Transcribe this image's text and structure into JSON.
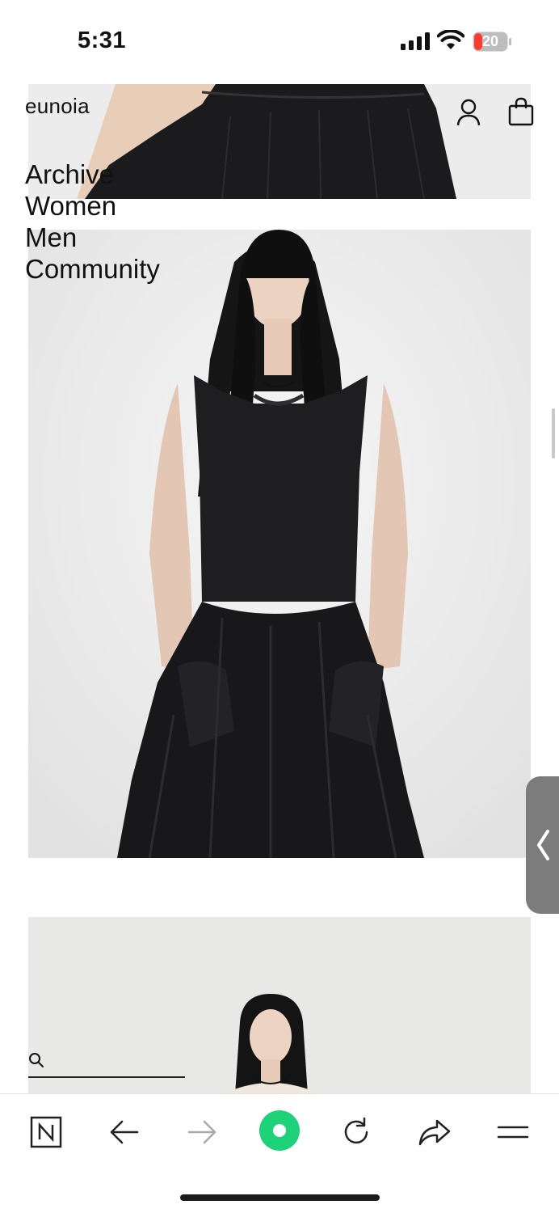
{
  "status_bar": {
    "time": "5:31",
    "battery_level": "20",
    "icons": [
      "cellular-signal-icon",
      "wifi-icon",
      "battery-icon"
    ]
  },
  "site": {
    "brand": "eunoia",
    "header_icons": [
      "user-icon",
      "shopping-bag-icon"
    ]
  },
  "nav": {
    "items": [
      {
        "label": "Archive"
      },
      {
        "label": "Women"
      },
      {
        "label": "Men"
      },
      {
        "label": "Community"
      }
    ]
  },
  "search": {
    "icon": "search-icon",
    "value": ""
  },
  "toolbar": {
    "buttons": [
      "naver-icon",
      "back-arrow-icon",
      "forward-arrow-icon",
      "green-dot-icon",
      "reload-icon",
      "share-icon",
      "menu-icon"
    ]
  },
  "colors": {
    "accent_green": "#1ed27a",
    "battery_red": "#ff3b30",
    "text": "#111111"
  }
}
